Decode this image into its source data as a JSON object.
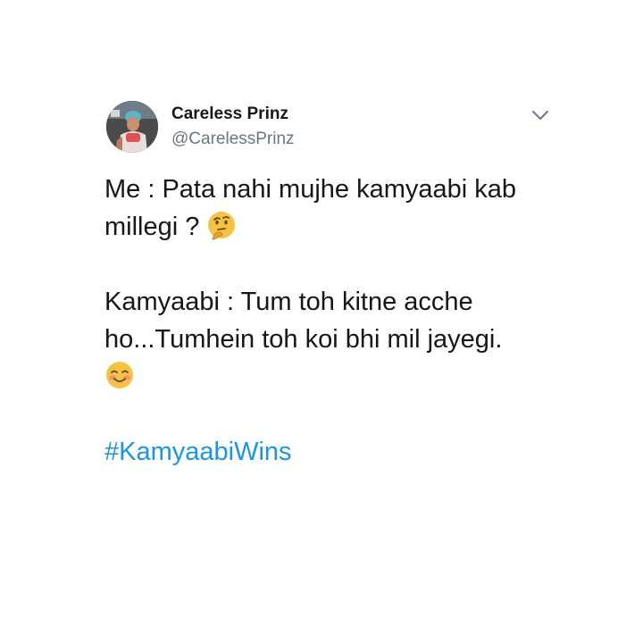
{
  "user": {
    "display_name": "Careless Prinz",
    "handle": "@CarelessPrinz"
  },
  "tweet": {
    "line1": "Me : Pata nahi mujhe kamyaabi kab millegi ?",
    "line2": "Kamyaabi : Tum toh kitne acche ho...Tumhein toh koi bhi mil jayegi.",
    "hashtag": "#KamyaabiWins",
    "emoji1": "thinking-face",
    "emoji2": "smiling-face-with-smiling-eyes"
  },
  "colors": {
    "text": "#14171a",
    "secondary": "#657786",
    "link": "#1b95e0",
    "background": "#ffffff"
  },
  "icons": {
    "caret": "chevron-down-icon"
  }
}
